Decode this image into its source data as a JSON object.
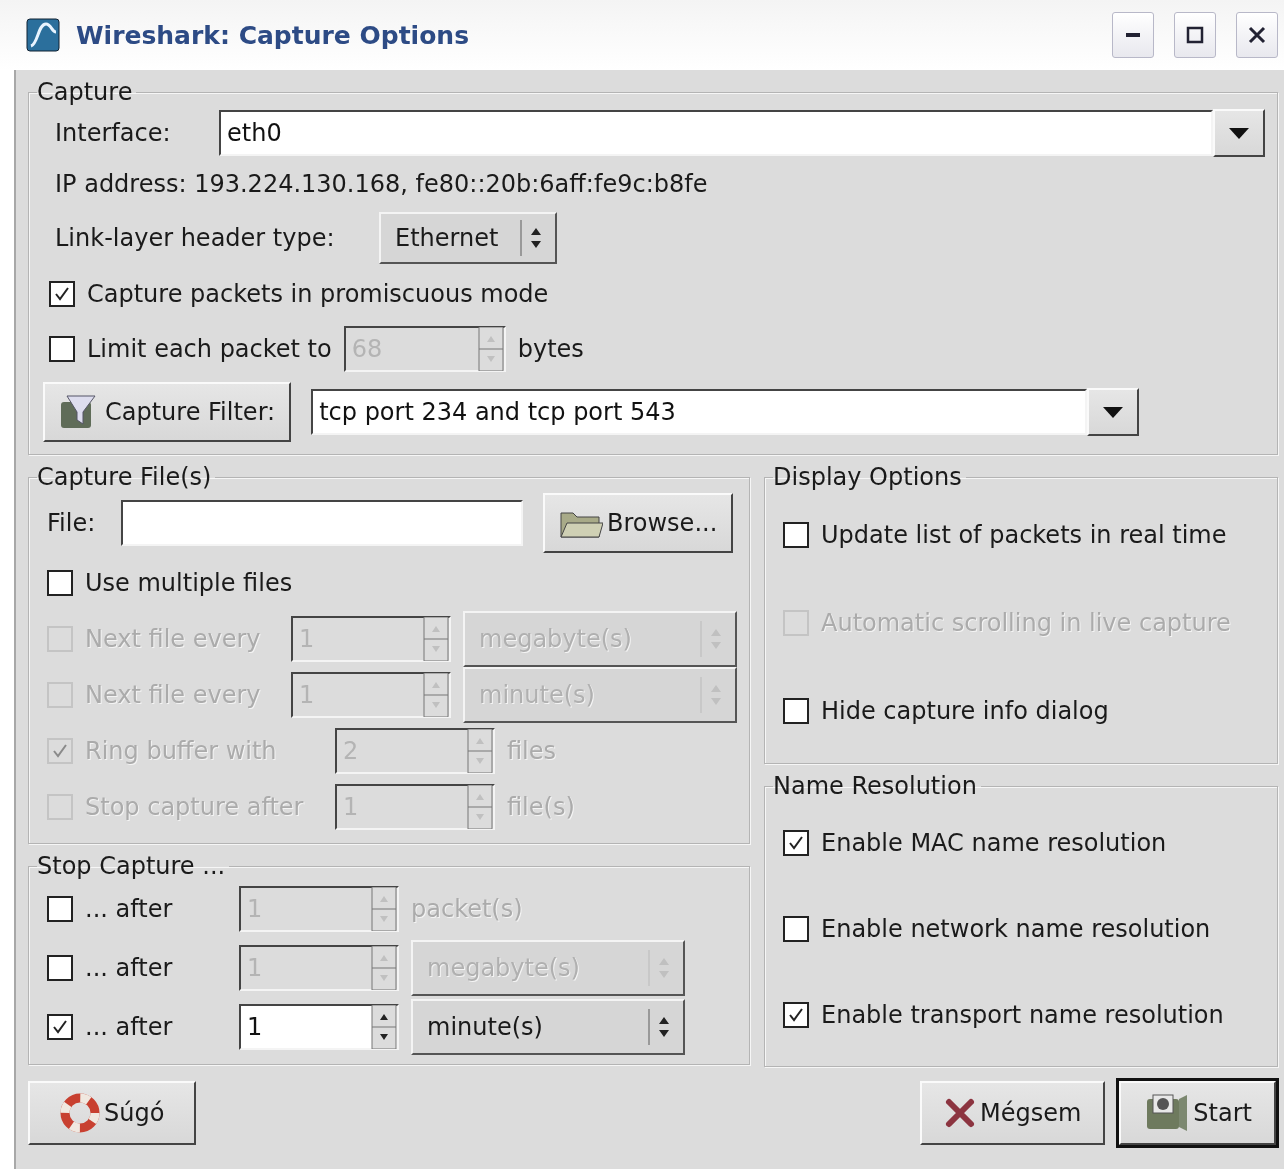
{
  "window": {
    "title": "Wireshark: Capture Options"
  },
  "capture": {
    "legend": "Capture",
    "interface": {
      "label": "Interface:",
      "value": "eth0"
    },
    "ip_address": "IP address: 193.224.130.168, fe80::20b:6aff:fe9c:b8fe",
    "link_layer": {
      "label": "Link-layer header type:",
      "value": "Ethernet"
    },
    "promiscuous": {
      "label": "Capture packets in promiscuous mode",
      "checked": true
    },
    "limit": {
      "label": "Limit each packet to",
      "checked": false,
      "value": "68",
      "unit": "bytes"
    },
    "filter": {
      "button": "Capture Filter:",
      "value": "tcp port 234 and tcp port 543"
    }
  },
  "capture_files": {
    "legend": "Capture File(s)",
    "file_label": "File:",
    "browse": "Browse...",
    "multiple": {
      "label": "Use multiple files",
      "checked": false
    },
    "rows": [
      {
        "kind": "dropdown",
        "label": "Next file every",
        "checked": false,
        "disabled": true,
        "value": "1",
        "unit": "megabyte(s)"
      },
      {
        "kind": "dropdown",
        "label": "Next file every",
        "checked": false,
        "disabled": true,
        "value": "1",
        "unit": "minute(s)"
      },
      {
        "kind": "text",
        "label": "Ring buffer with",
        "checked": true,
        "disabled": true,
        "value": "2",
        "unit": "files"
      },
      {
        "kind": "text",
        "label": "Stop capture after",
        "checked": false,
        "disabled": true,
        "value": "1",
        "unit": "file(s)"
      }
    ]
  },
  "stop_capture": {
    "legend": "Stop Capture ...",
    "rows": [
      {
        "kind": "text",
        "label": "... after",
        "checked": false,
        "value": "1",
        "unit": "packet(s)"
      },
      {
        "kind": "dropdown",
        "label": "... after",
        "checked": false,
        "value": "1",
        "unit": "megabyte(s)"
      },
      {
        "kind": "dropdown",
        "label": "... after",
        "checked": true,
        "value": "1",
        "unit": "minute(s)"
      }
    ]
  },
  "display_options": {
    "legend": "Display Options",
    "items": [
      {
        "label": "Update list of packets in real time",
        "checked": false,
        "disabled": false
      },
      {
        "label": "Automatic scrolling in live capture",
        "checked": false,
        "disabled": true
      },
      {
        "label": "Hide capture info dialog",
        "checked": false,
        "disabled": false
      }
    ]
  },
  "name_resolution": {
    "legend": "Name Resolution",
    "items": [
      {
        "label": "Enable MAC name resolution",
        "checked": true
      },
      {
        "label": "Enable network name resolution",
        "checked": false
      },
      {
        "label": "Enable transport name resolution",
        "checked": true
      }
    ]
  },
  "buttons": [
    {
      "kind": "help",
      "label": "Súgó",
      "default": false
    },
    {
      "kind": "cancel",
      "label": "Mégsem",
      "default": false
    },
    {
      "kind": "start",
      "label": "Start",
      "default": true
    }
  ]
}
